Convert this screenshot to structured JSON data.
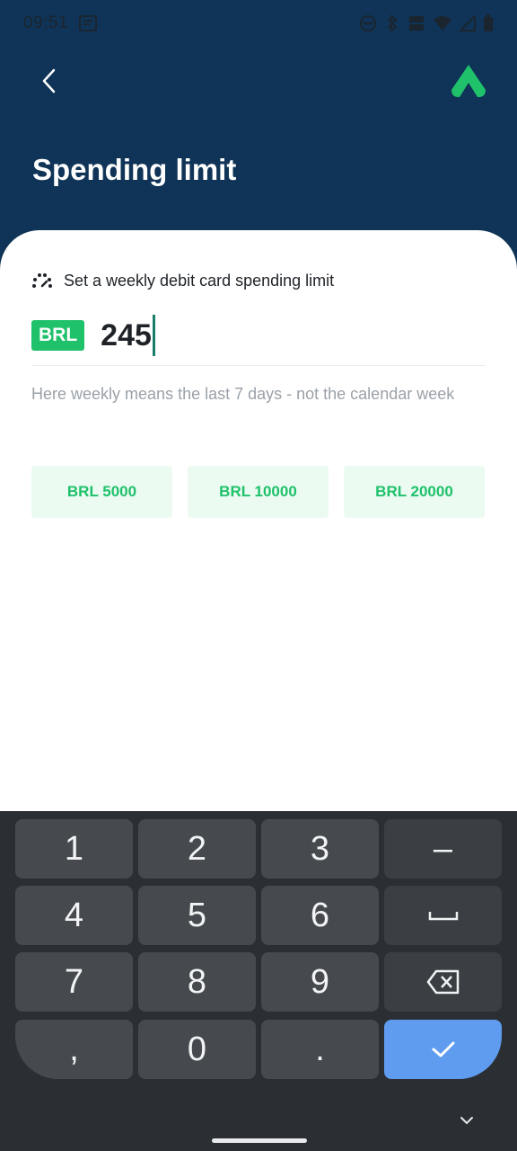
{
  "status_bar": {
    "time": "09:51"
  },
  "header": {
    "title": "Spending limit"
  },
  "limit": {
    "label": "Set a weekly debit card spending limit",
    "currency": "BRL",
    "amount": "245",
    "hint": "Here weekly means the last 7 days - not the calendar week"
  },
  "presets": [
    {
      "label": "BRL 5000"
    },
    {
      "label": "BRL 10000"
    },
    {
      "label": "BRL 20000"
    }
  ],
  "keyboard": {
    "keys": [
      "1",
      "2",
      "3",
      "–",
      "4",
      "5",
      "6",
      "7",
      "8",
      "9",
      ",",
      "0",
      "."
    ]
  },
  "colors": {
    "header_bg": "#0f3457",
    "accent_green": "#1fc16b",
    "preset_bg": "#ebfbf1",
    "enter_key": "#5f9cf0"
  }
}
